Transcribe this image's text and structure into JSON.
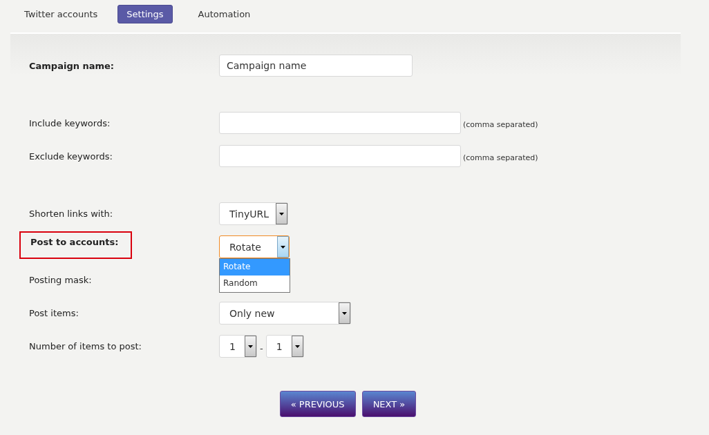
{
  "tabs": [
    {
      "label": "Twitter accounts",
      "selected": false
    },
    {
      "label": "Settings",
      "selected": true
    },
    {
      "label": "Automation",
      "selected": false
    }
  ],
  "sections": [
    {
      "rows": [
        {
          "kind": "text",
          "label": "Campaign name:",
          "bold": true,
          "highlighted": false,
          "value": "Campaign name"
        }
      ]
    },
    {
      "rows": [
        {
          "kind": "text",
          "label": "Include keywords:",
          "bold": false,
          "highlighted": false,
          "wide": true,
          "note": "(comma separated)"
        },
        {
          "kind": "text",
          "label": "Exclude keywords:",
          "bold": false,
          "highlighted": false,
          "wide": true,
          "note": "(comma separated)"
        }
      ]
    },
    {
      "rows": [
        {
          "kind": "select",
          "label": "Shorten links with:",
          "bold": false,
          "highlighted": false,
          "value": "TinyURL",
          "focused": false
        },
        {
          "kind": "select",
          "label": "Post to accounts:",
          "bold": true,
          "highlighted": true,
          "value": "Rotate",
          "focused": true,
          "options": [
            {
              "label": "Rotate",
              "selected": true
            },
            {
              "label": "Random",
              "selected": false
            }
          ]
        },
        {
          "kind": "none",
          "label": "Posting mask:",
          "bold": false,
          "highlighted": false
        },
        {
          "kind": "select",
          "label": "Post items:",
          "bold": false,
          "highlighted": false,
          "value": "Only new",
          "focused": false,
          "wide": true
        },
        {
          "kind": "range",
          "label": "Number of items to post:",
          "bold": false,
          "highlighted": false,
          "from": "1",
          "separator": "-",
          "to": "1"
        }
      ]
    }
  ],
  "buttons": [
    "« PREVIOUS",
    "NEXT »"
  ]
}
